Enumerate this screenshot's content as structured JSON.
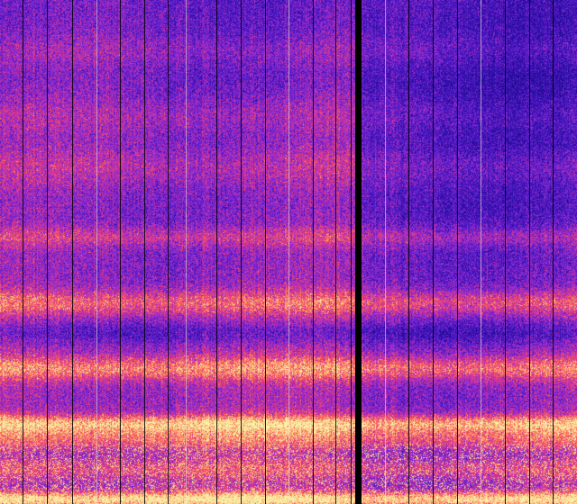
{
  "image": {
    "kind": "spectrogram",
    "palette": {
      "low": "#1a0a8c",
      "low_mid": "#4b17c8",
      "mid": "#9a2fd0",
      "mid_high": "#e0328c",
      "high": "#ff6b4a",
      "peak": "#f8f3a8"
    },
    "divider_color": "#000000",
    "segments": 2
  }
}
